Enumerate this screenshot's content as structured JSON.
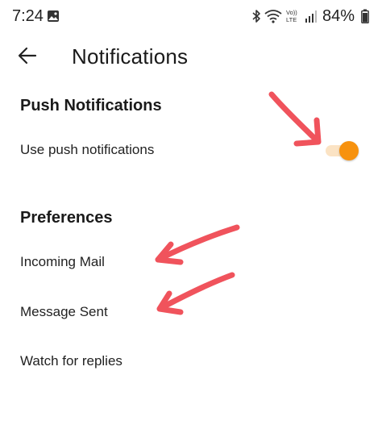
{
  "status_bar": {
    "time": "7:24",
    "battery": "84%",
    "icons": [
      "gallery-icon",
      "bluetooth-icon",
      "wifi-icon",
      "volte-icon",
      "signal-icon",
      "battery-icon"
    ]
  },
  "header": {
    "back_icon": "arrow-left-icon",
    "title": "Notifications"
  },
  "push_section": {
    "title": "Push Notifications",
    "rows": [
      {
        "label": "Use push notifications",
        "toggle_on": true
      }
    ]
  },
  "preferences_section": {
    "title": "Preferences",
    "rows": [
      {
        "label": "Incoming Mail"
      },
      {
        "label": "Message Sent"
      },
      {
        "label": "Watch for replies"
      }
    ]
  },
  "colors": {
    "accent": "#f7920f",
    "toggle_track": "#fbe3c4",
    "annotation_arrow": "#f0535c"
  },
  "status_icons_text": {
    "volte": "Vo)) LTE"
  }
}
